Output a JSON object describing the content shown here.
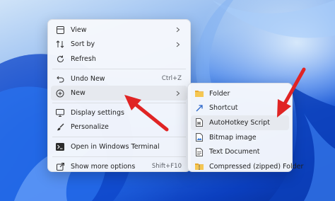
{
  "context_menu": {
    "items": [
      {
        "label": "View"
      },
      {
        "label": "Sort by"
      },
      {
        "label": "Refresh"
      },
      {
        "label": "Undo New",
        "shortcut": "Ctrl+Z"
      },
      {
        "label": "New"
      },
      {
        "label": "Display settings"
      },
      {
        "label": "Personalize"
      },
      {
        "label": "Open in Windows Terminal"
      },
      {
        "label": "Show more options",
        "shortcut": "Shift+F10"
      }
    ]
  },
  "new_submenu": {
    "items": [
      {
        "label": "Folder",
        "icon": "folder-icon"
      },
      {
        "label": "Shortcut",
        "icon": "shortcut-icon"
      },
      {
        "label": "AutoHotkey Script",
        "icon": "script-file-icon"
      },
      {
        "label": "Bitmap image",
        "icon": "image-file-icon"
      },
      {
        "label": "Text Document",
        "icon": "text-file-icon"
      },
      {
        "label": "Compressed (zipped) Folder",
        "icon": "zip-folder-icon"
      }
    ]
  },
  "colors": {
    "accent_arrow": "#e02424",
    "folder": "#f2c14e",
    "menu_bg": "#f6f8fc"
  }
}
